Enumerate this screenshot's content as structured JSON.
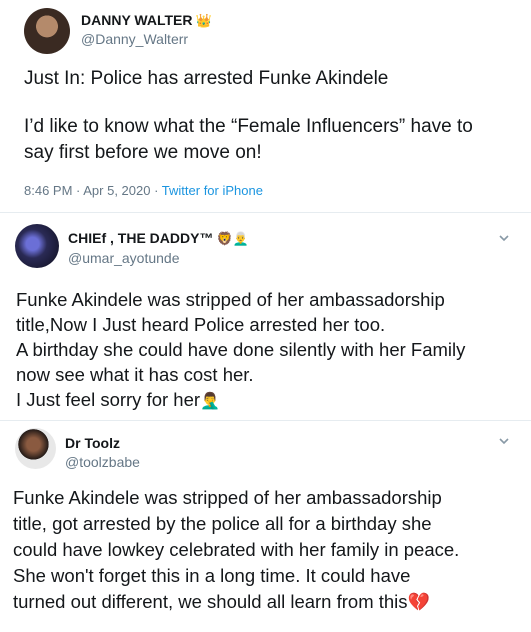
{
  "tweet": {
    "name": "DANNY WALTER",
    "name_badge": "👑",
    "handle": "@Danny_Walterr",
    "text_line1": "Just In: Police has arrested Funke Akindele",
    "text_line2": "I’d like to know what the “Female Influencers” have to say first before we move on!",
    "time": "8:46 PM · Apr 5, 2020 · ",
    "source": "Twitter for iPhone"
  },
  "replies": [
    {
      "name": "CHIEf , THE DADDY™",
      "name_badges": "🦁👨‍🦳",
      "handle": "@umar_ayotunde",
      "lines": [
        "Funke Akindele was stripped of  her ambassadorship",
        "title,Now I Just heard Police arrested her too.",
        "A birthday she could have done silently with her Family",
        "now see what it has cost her.",
        "I Just feel sorry for her"
      ],
      "end_emoji": "🤦‍♂️",
      "menu_icon": "chevron-down-icon"
    },
    {
      "name": "Dr Toolz",
      "handle": "@toolzbabe",
      "lines": [
        "Funke Akindele was stripped of  her ambassadorship",
        "title, got arrested by the police all for a birthday she",
        "could have lowkey celebrated with her family in peace.",
        "She won't forget this in a long time. It could have",
        "turned out different, we should all learn from this"
      ],
      "end_emoji": "💔",
      "menu_icon": "chevron-down-icon"
    }
  ],
  "colors": {
    "text": "#14171a",
    "secondary": "#657786",
    "link": "#1b95e0",
    "divider": "#e6ecf0"
  }
}
